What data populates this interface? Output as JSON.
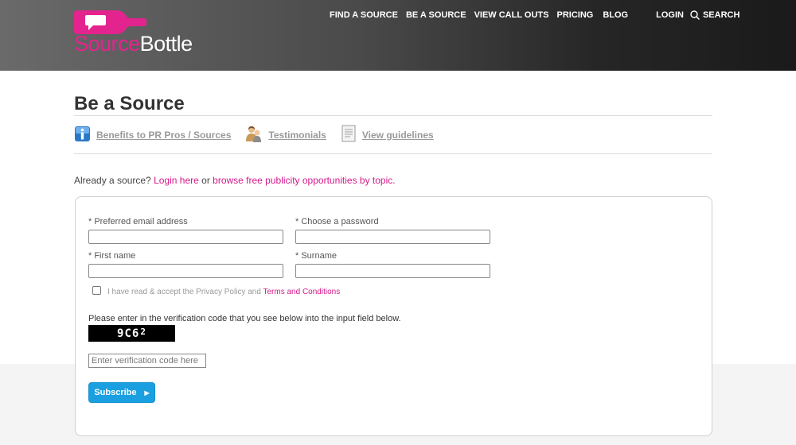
{
  "brand": {
    "name_part1": "Source",
    "name_part2": "Bottle",
    "brand_pink": "#e4248e",
    "accent_blue": "#1aa0e0"
  },
  "nav": {
    "items": [
      "FIND A SOURCE",
      "BE A SOURCE",
      "VIEW CALL OUTS",
      "PRICING",
      "BLOG",
      "LOGIN"
    ],
    "search_label": "SEARCH"
  },
  "page": {
    "title": "Be a Source",
    "sublinks": [
      {
        "label": "Benefits to PR Pros / Sources",
        "icon": "info-icon"
      },
      {
        "label": "Testimonials",
        "icon": "people-icon"
      },
      {
        "label": "View guidelines",
        "icon": "document-icon"
      }
    ],
    "already": {
      "prefix": "Already a source?",
      "login_link": "Login here",
      "middle": "or",
      "browse_link": "browse free publicity opportunities by topic",
      "suffix": "."
    }
  },
  "form": {
    "email_label": "* Preferred email address",
    "email_value": "",
    "password_label": "* Choose a password",
    "password_value": "",
    "firstname_label": "* First name",
    "firstname_value": "",
    "surname_label": "* Surname",
    "surname_value": "",
    "terms_text": "I have read & accept the Privacy Policy and",
    "terms_link": "Terms and Conditions",
    "terms_checked": false,
    "verify_text": "Please enter in the verification code that you see below into the input field below.",
    "captcha_main": "9C6",
    "captcha_sup": "2",
    "verify_placeholder": "Enter verification code here",
    "submit_label": "Subscribe"
  }
}
